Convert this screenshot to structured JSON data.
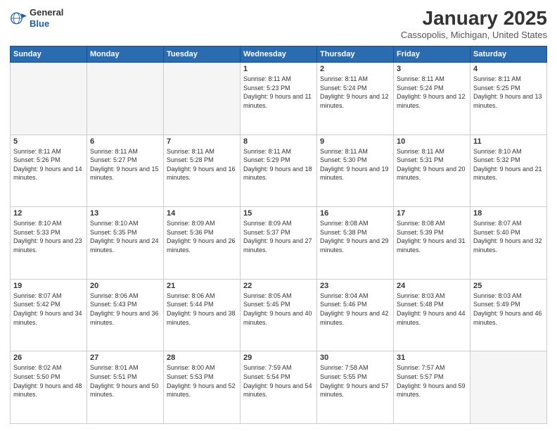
{
  "header": {
    "logo_general": "General",
    "logo_blue": "Blue",
    "month": "January 2025",
    "location": "Cassopolis, Michigan, United States"
  },
  "days_of_week": [
    "Sunday",
    "Monday",
    "Tuesday",
    "Wednesday",
    "Thursday",
    "Friday",
    "Saturday"
  ],
  "weeks": [
    [
      {
        "day": "",
        "empty": true
      },
      {
        "day": "",
        "empty": true
      },
      {
        "day": "",
        "empty": true
      },
      {
        "day": "1",
        "sunrise": "8:11 AM",
        "sunset": "5:23 PM",
        "daylight": "9 hours and 11 minutes."
      },
      {
        "day": "2",
        "sunrise": "8:11 AM",
        "sunset": "5:24 PM",
        "daylight": "9 hours and 12 minutes."
      },
      {
        "day": "3",
        "sunrise": "8:11 AM",
        "sunset": "5:24 PM",
        "daylight": "9 hours and 12 minutes."
      },
      {
        "day": "4",
        "sunrise": "8:11 AM",
        "sunset": "5:25 PM",
        "daylight": "9 hours and 13 minutes."
      }
    ],
    [
      {
        "day": "5",
        "sunrise": "8:11 AM",
        "sunset": "5:26 PM",
        "daylight": "9 hours and 14 minutes."
      },
      {
        "day": "6",
        "sunrise": "8:11 AM",
        "sunset": "5:27 PM",
        "daylight": "9 hours and 15 minutes."
      },
      {
        "day": "7",
        "sunrise": "8:11 AM",
        "sunset": "5:28 PM",
        "daylight": "9 hours and 16 minutes."
      },
      {
        "day": "8",
        "sunrise": "8:11 AM",
        "sunset": "5:29 PM",
        "daylight": "9 hours and 18 minutes."
      },
      {
        "day": "9",
        "sunrise": "8:11 AM",
        "sunset": "5:30 PM",
        "daylight": "9 hours and 19 minutes."
      },
      {
        "day": "10",
        "sunrise": "8:11 AM",
        "sunset": "5:31 PM",
        "daylight": "9 hours and 20 minutes."
      },
      {
        "day": "11",
        "sunrise": "8:10 AM",
        "sunset": "5:32 PM",
        "daylight": "9 hours and 21 minutes."
      }
    ],
    [
      {
        "day": "12",
        "sunrise": "8:10 AM",
        "sunset": "5:33 PM",
        "daylight": "9 hours and 23 minutes."
      },
      {
        "day": "13",
        "sunrise": "8:10 AM",
        "sunset": "5:35 PM",
        "daylight": "9 hours and 24 minutes."
      },
      {
        "day": "14",
        "sunrise": "8:09 AM",
        "sunset": "5:36 PM",
        "daylight": "9 hours and 26 minutes."
      },
      {
        "day": "15",
        "sunrise": "8:09 AM",
        "sunset": "5:37 PM",
        "daylight": "9 hours and 27 minutes."
      },
      {
        "day": "16",
        "sunrise": "8:08 AM",
        "sunset": "5:38 PM",
        "daylight": "9 hours and 29 minutes."
      },
      {
        "day": "17",
        "sunrise": "8:08 AM",
        "sunset": "5:39 PM",
        "daylight": "9 hours and 31 minutes."
      },
      {
        "day": "18",
        "sunrise": "8:07 AM",
        "sunset": "5:40 PM",
        "daylight": "9 hours and 32 minutes."
      }
    ],
    [
      {
        "day": "19",
        "sunrise": "8:07 AM",
        "sunset": "5:42 PM",
        "daylight": "9 hours and 34 minutes."
      },
      {
        "day": "20",
        "sunrise": "8:06 AM",
        "sunset": "5:43 PM",
        "daylight": "9 hours and 36 minutes."
      },
      {
        "day": "21",
        "sunrise": "8:06 AM",
        "sunset": "5:44 PM",
        "daylight": "9 hours and 38 minutes."
      },
      {
        "day": "22",
        "sunrise": "8:05 AM",
        "sunset": "5:45 PM",
        "daylight": "9 hours and 40 minutes."
      },
      {
        "day": "23",
        "sunrise": "8:04 AM",
        "sunset": "5:46 PM",
        "daylight": "9 hours and 42 minutes."
      },
      {
        "day": "24",
        "sunrise": "8:03 AM",
        "sunset": "5:48 PM",
        "daylight": "9 hours and 44 minutes."
      },
      {
        "day": "25",
        "sunrise": "8:03 AM",
        "sunset": "5:49 PM",
        "daylight": "9 hours and 46 minutes."
      }
    ],
    [
      {
        "day": "26",
        "sunrise": "8:02 AM",
        "sunset": "5:50 PM",
        "daylight": "9 hours and 48 minutes."
      },
      {
        "day": "27",
        "sunrise": "8:01 AM",
        "sunset": "5:51 PM",
        "daylight": "9 hours and 50 minutes."
      },
      {
        "day": "28",
        "sunrise": "8:00 AM",
        "sunset": "5:53 PM",
        "daylight": "9 hours and 52 minutes."
      },
      {
        "day": "29",
        "sunrise": "7:59 AM",
        "sunset": "5:54 PM",
        "daylight": "9 hours and 54 minutes."
      },
      {
        "day": "30",
        "sunrise": "7:58 AM",
        "sunset": "5:55 PM",
        "daylight": "9 hours and 57 minutes."
      },
      {
        "day": "31",
        "sunrise": "7:57 AM",
        "sunset": "5:57 PM",
        "daylight": "9 hours and 59 minutes."
      },
      {
        "day": "",
        "empty": true
      }
    ]
  ],
  "labels": {
    "sunrise": "Sunrise:",
    "sunset": "Sunset:",
    "daylight": "Daylight:"
  }
}
